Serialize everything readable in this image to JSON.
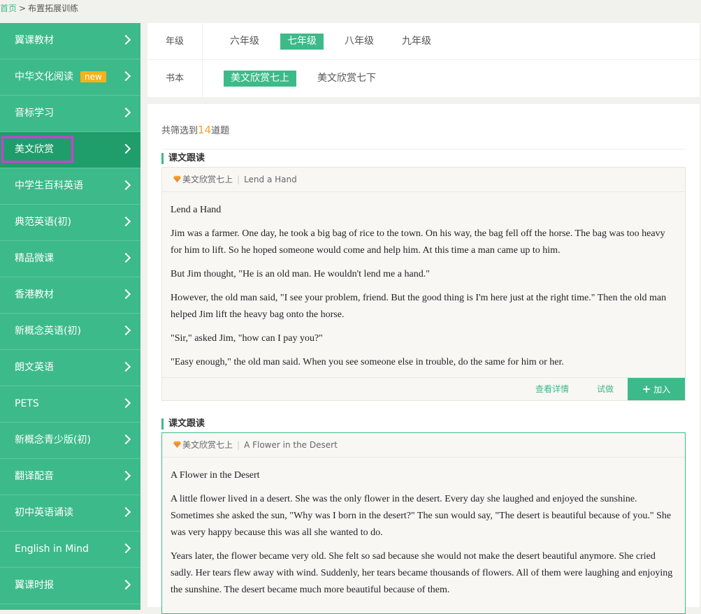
{
  "breadcrumb": {
    "home": "首页",
    "separator": ">",
    "current": "布置拓展训练"
  },
  "sidebar": {
    "items": [
      {
        "label": "翼课教材"
      },
      {
        "label": "中华文化阅读",
        "badge": "new"
      },
      {
        "label": "音标学习"
      },
      {
        "label": "美文欣赏",
        "active": true
      },
      {
        "label": "中学生百科英语"
      },
      {
        "label": "典范英语(初)"
      },
      {
        "label": "精品微课"
      },
      {
        "label": "香港教材"
      },
      {
        "label": "新概念英语(初)"
      },
      {
        "label": "朗文英语"
      },
      {
        "label": "PETS"
      },
      {
        "label": "新概念青少版(初)"
      },
      {
        "label": "翻译配音"
      },
      {
        "label": "初中英语诵读"
      },
      {
        "label": "English in Mind"
      },
      {
        "label": "翼课时报"
      }
    ]
  },
  "filter": {
    "grade": {
      "label": "年级",
      "options": [
        "六年级",
        "七年级",
        "八年级",
        "九年级"
      ],
      "selected": "七年级"
    },
    "book": {
      "label": "书本",
      "options": [
        "美文欣赏七上",
        "美文欣赏七下"
      ],
      "selected": "美文欣赏七上"
    }
  },
  "results": {
    "prefix": "共筛选到",
    "count": "14",
    "suffix": "道题"
  },
  "colors": {
    "accent": "#3dba89",
    "count": "#f5a623",
    "badge": "#f5b21a",
    "highlight": "#d63ad6"
  },
  "cards": [
    {
      "section": "课文跟读",
      "book": "美文欣赏七上",
      "title": "Lend a Hand",
      "paragraphs": [
        "Lend a Hand",
        "Jim was a farmer. One day, he took a big bag of rice to the town. On his way, the bag fell off the horse. The bag was too heavy for him to lift. So he hoped someone would come and help him. At this time a man came up to him.",
        "But Jim thought, \"He is an old man. He wouldn't lend me a hand.\"",
        "However, the old man said, \"I see your problem, friend. But the good thing is I'm here just at the right time.\" Then the old man helped Jim lift the heavy bag onto the horse.",
        "\"Sir,\" asked Jim, \"how can I pay you?\"",
        "\"Easy enough,\" the old man said. When you see someone else in trouble, do the same for him or her."
      ],
      "actions": {
        "detail": "查看详情",
        "try": "试做",
        "add": "加入"
      }
    },
    {
      "section": "课文跟读",
      "book": "美文欣赏七上",
      "title": "A Flower in the Desert",
      "paragraphs": [
        "A Flower in the Desert",
        "A little flower lived in a desert. She was the only flower in the desert. Every day she laughed and enjoyed the sunshine. Sometimes she asked the sun, \"Why was I born in the desert?\" The sun would say, \"The desert is beautiful because of you.\" She was very happy because this was all she wanted to do.",
        "Years later, the flower became very old. She felt so sad because she would not make the desert beautiful anymore. She cried sadly. Her tears flew away with wind. Suddenly, her tears became thousands of flowers. All of them were laughing and enjoying the sunshine. The desert became much more beautiful because of them."
      ]
    }
  ]
}
